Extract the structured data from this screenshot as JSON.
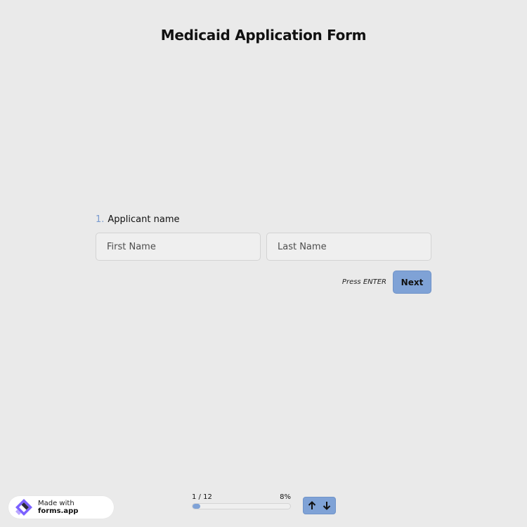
{
  "form": {
    "title": "Medicaid Application Form"
  },
  "question": {
    "number": "1.",
    "label": "Applicant name",
    "first_name": {
      "value": "",
      "placeholder": "First Name"
    },
    "last_name": {
      "value": "",
      "placeholder": "Last Name"
    }
  },
  "actions": {
    "press_hint": "Press ENTER",
    "next_label": "Next"
  },
  "branding": {
    "prefix": "Made with",
    "name": "forms.app",
    "logo_icon": "forms-app-logo-icon"
  },
  "progress": {
    "counter": "1 / 12",
    "percent_label": "8%",
    "fraction": 0.08
  },
  "nav": {
    "up_icon": "arrow-up-icon",
    "down_icon": "arrow-down-icon"
  },
  "colors": {
    "background": "#eaeaea",
    "accent": "#7fa2d6",
    "number_accent": "#7a9bd0",
    "brand_purple": "#7b61ff"
  }
}
